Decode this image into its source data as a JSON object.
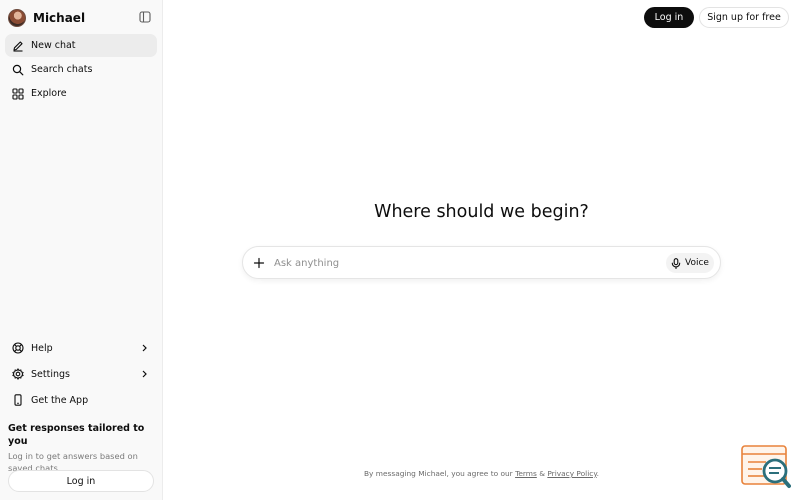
{
  "sidebar": {
    "brand_name": "Michael",
    "nav": [
      {
        "label": "New chat",
        "icon": "pencil-icon"
      },
      {
        "label": "Search chats",
        "icon": "search-icon"
      },
      {
        "label": "Explore",
        "icon": "grid-icon"
      }
    ],
    "bottom": [
      {
        "label": "Help",
        "icon": "help-icon"
      },
      {
        "label": "Settings",
        "icon": "gear-icon"
      },
      {
        "label": "Get the App",
        "icon": "phone-icon"
      }
    ],
    "promo_title": "Get responses tailored to you",
    "promo_text": "Log in to get answers based on saved chats.",
    "login_label": "Log in"
  },
  "topbar": {
    "login_label": "Log in",
    "signup_label": "Sign up for free"
  },
  "main": {
    "headline": "Where should we begin?",
    "prompt_placeholder": "Ask anything",
    "voice_label": "Voice"
  },
  "footer": {
    "prefix": "By messaging Michael, you agree to our",
    "terms": "Terms",
    "amp": "&",
    "privacy": "Privacy Policy",
    "suffix": "."
  },
  "colors": {
    "primary": "#0d0d0d",
    "sidebar_bg": "#f9f9f9",
    "badge_orange": "#e8823a",
    "badge_teal": "#2b6f7b"
  }
}
